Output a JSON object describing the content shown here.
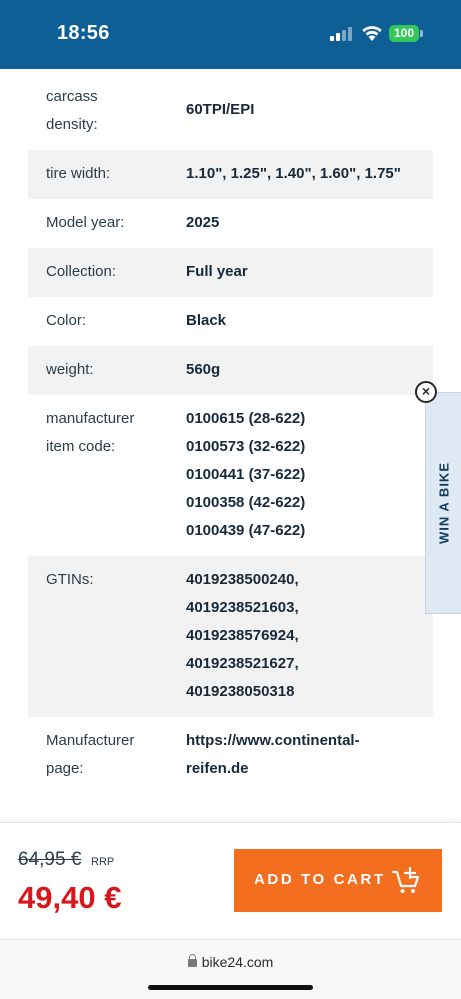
{
  "status_bar": {
    "time": "18:56",
    "battery": "100",
    "colors": {
      "background": "#0e5f95",
      "battery": "#33c759"
    }
  },
  "specs": [
    {
      "label_lines": [
        "carcass",
        "density:"
      ],
      "values": [
        "60TPI/EPI"
      ]
    },
    {
      "label_lines": [
        "tire width:"
      ],
      "values": [
        "1.10\", 1.25\", 1.40\", 1.60\", 1.75\""
      ]
    },
    {
      "label_lines": [
        "Model year:"
      ],
      "values": [
        "2025"
      ]
    },
    {
      "label_lines": [
        "Collection:"
      ],
      "values": [
        "Full year"
      ]
    },
    {
      "label_lines": [
        "Color:"
      ],
      "values": [
        "Black"
      ]
    },
    {
      "label_lines": [
        "weight:"
      ],
      "values": [
        "560g"
      ]
    },
    {
      "label_lines": [
        "manufacturer",
        "item code:"
      ],
      "values": [
        "0100615 (28-622)",
        "0100573 (32-622)",
        "0100441 (37-622)",
        "0100358 (42-622)",
        "0100439 (47-622)"
      ]
    },
    {
      "label_lines": [
        "GTINs:"
      ],
      "values": [
        "4019238500240,",
        "4019238521603,",
        "4019238576924,",
        "4019238521627,",
        "4019238050318"
      ]
    },
    {
      "label_lines": [
        "Manufacturer",
        "page:"
      ],
      "values": [
        "https://www.continental-",
        "reifen.de"
      ]
    }
  ],
  "promo": {
    "tab_label": "WIN A BIKE",
    "close_icon": "close-icon"
  },
  "purchase": {
    "old_price": "64,95 €",
    "rrp_label": "RRP",
    "new_price": "49,40 €",
    "add_to_cart_label": "ADD TO CART",
    "cart_icon": "cart-add-icon",
    "colors": {
      "button": "#f36f1f",
      "price": "#d8161b"
    }
  },
  "browser": {
    "url": "bike24.com",
    "lock_icon": "lock-icon"
  }
}
